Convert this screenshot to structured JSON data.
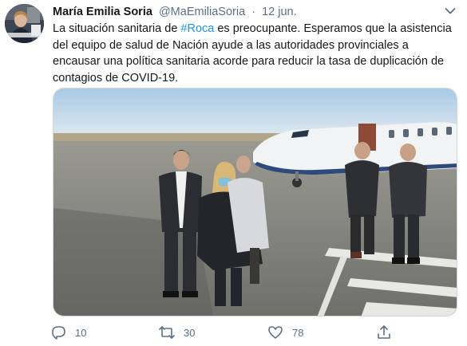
{
  "tweet": {
    "author_name": "María Emilia Soria",
    "handle": "@MaEmiliaSoria",
    "separator": "·",
    "date": "12 jun.",
    "text_before": "La situación sanitaria de ",
    "hashtag": "#Roca",
    "text_after": " es preocupante. Esperamos que la asistencia del equipo de salud de Nación ayude a las autoridades provinciales a encausar una política sanitaria acorde para reducir la tasa de duplicación de contagios de COVID-19."
  },
  "actions": {
    "replies": "10",
    "retweets": "30",
    "likes": "78"
  },
  "icons": {
    "reply": "speech-bubble-icon",
    "retweet": "retweet-arrows-icon",
    "like": "heart-icon",
    "share": "share-upload-icon",
    "menu": "chevron-down-icon"
  },
  "colors": {
    "link": "#1b95e0",
    "secondary_text": "#5b7083",
    "primary_text": "#14171a"
  }
}
